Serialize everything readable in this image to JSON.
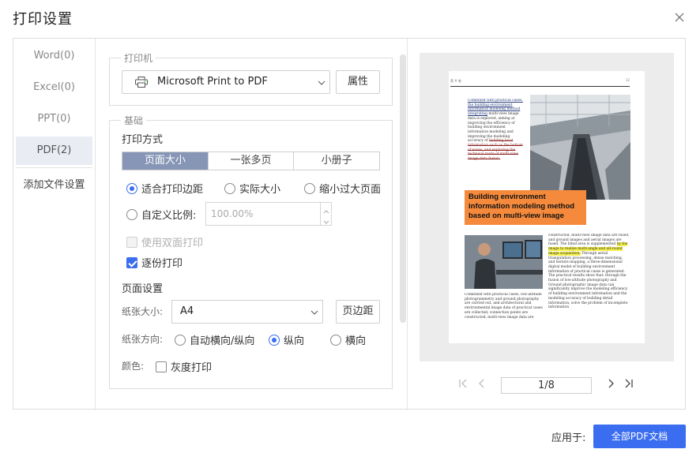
{
  "dialog": {
    "title": "打印设置"
  },
  "sidebar": {
    "items": [
      {
        "label": "Word(0)"
      },
      {
        "label": "Excel(0)"
      },
      {
        "label": "PPT(0)"
      },
      {
        "label": "PDF(2)"
      }
    ],
    "active_item": "PDF(2)",
    "add_label": "添加文件设置"
  },
  "printer": {
    "legend": "打印机",
    "selected": "Microsoft Print to PDF",
    "properties_label": "属性"
  },
  "basic": {
    "legend": "基础",
    "print_mode_label": "打印方式",
    "tabs": [
      {
        "label": "页面大小"
      },
      {
        "label": "一张多页"
      },
      {
        "label": "小册子"
      }
    ],
    "active_tab": "页面大小",
    "fit_options": [
      {
        "label": "适合打印边距"
      },
      {
        "label": "实际大小"
      },
      {
        "label": "缩小过大页面"
      }
    ],
    "selected_fit": "适合打印边距",
    "custom_scale_label": "自定义比例:",
    "custom_scale_value": "100.00%",
    "duplex_label": "使用双面打印",
    "duplex_checked": false,
    "duplex_disabled": true,
    "collate_label": "逐份打印",
    "collate_checked": true
  },
  "page_setup": {
    "title": "页面设置",
    "paper_size_label": "纸张大小:",
    "paper_size": "A4",
    "margins_label": "页边距",
    "orientation_label": "纸张方向:",
    "orientation_options": [
      {
        "label": "自动横向/纵向"
      },
      {
        "label": "纵向"
      },
      {
        "label": "横向"
      }
    ],
    "selected_orientation": "纵向",
    "color_label": "颜色:",
    "grayscale_label": "灰度打印",
    "grayscale_checked": false
  },
  "preview": {
    "header_left": "第 # 卷",
    "header_right": "12",
    "col1_text": [
      {
        "t": "Combined with practical cases, the building environment information modeling method integrating",
        "style": "u"
      },
      {
        "t": " multi-view image data is explored, aiming at improving the efficiency of building environment information modeling and improving the modeling accuracy of ",
        "style": ""
      },
      {
        "t": "building local information such as the bottom of eaves, and exploring the technical route of multi-view image data fusion.",
        "style": "s"
      }
    ],
    "heading": "Building environment information modeling method based on multi-view image",
    "col2_text": [
      {
        "t": "constructed, multi-view image data are fused, and ground images and aerial images are fused. The blind area is supplemented ",
        "style": ""
      },
      {
        "t": "by the image to realize multi-angle and all-round image acquisition.",
        "style": "hl"
      },
      {
        "t": " Through aerial triangulation processing, dense matching, and texture mapping, a three-dimensional digital model of building environment information of practical cases is generated. The practical results show that: through the fusion of low-altitude photography and Ground photographic image data can significantly improve the modeling efficiency of building environment information and the modeling accuracy of building detail information, solve the problem of incomplete information",
        "style": ""
      }
    ],
    "col3_text": "Combined with practical cases, low-altitude photogrammetry and ground photography are carried out, and architectural and environmental image data of practical cases are collected; connection points are constructed, multi-view image data are",
    "current_page": 1,
    "total_pages": 8,
    "page_indicator": "1/8"
  },
  "footer": {
    "apply_label": "应用于:",
    "apply_button": "全部PDF文档",
    "accent_color": "#3b6df0"
  }
}
